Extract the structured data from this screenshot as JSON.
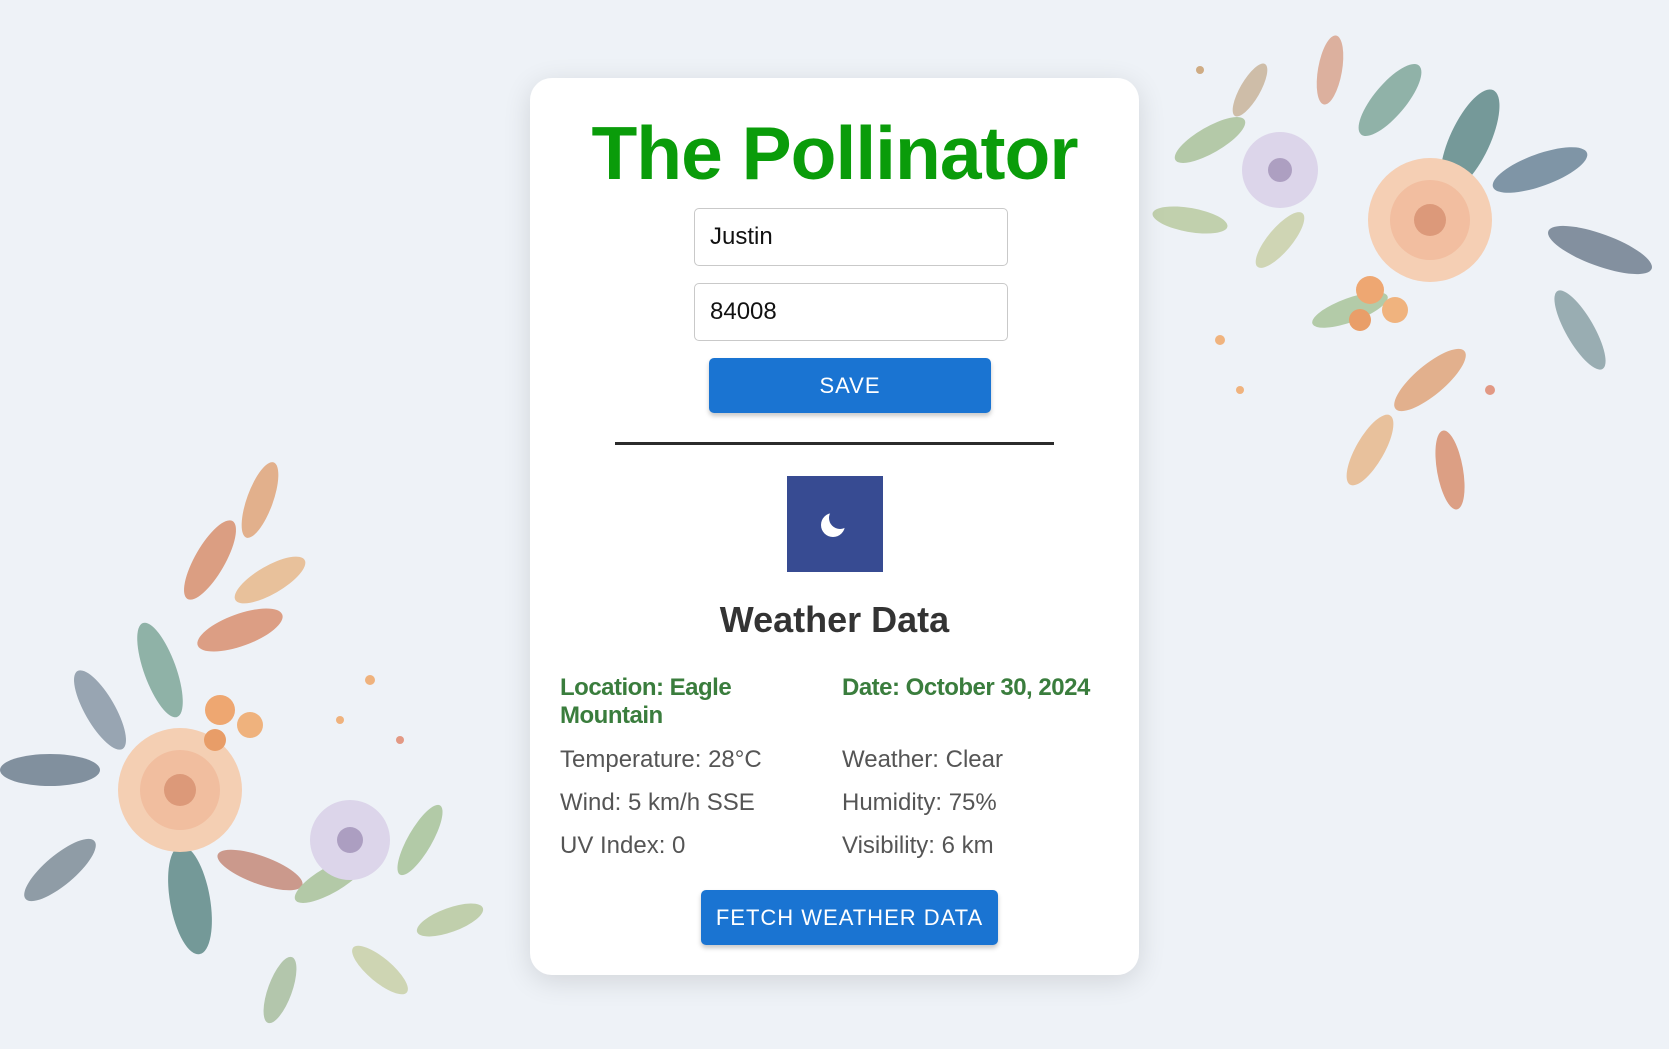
{
  "app": {
    "title": "The Pollinator"
  },
  "form": {
    "name_value": "Justin",
    "zip_value": "84008",
    "save_label": "SAVE"
  },
  "weather": {
    "icon": "crescent-moon-icon",
    "heading": "Weather Data",
    "location": "Location: Eagle Mountain",
    "date": "Date: October 30, 2024",
    "temperature": "Temperature: 28°C",
    "condition": "Weather: Clear",
    "wind": "Wind: 5 km/h SSE",
    "humidity": "Humidity: 75%",
    "uv_index": "UV Index: 0",
    "visibility": "Visibility: 6 km",
    "fetch_label": "FETCH WEATHER DATA"
  },
  "colors": {
    "title_green": "#0a9c0a",
    "label_green": "#3a7d3d",
    "button_blue": "#1a74d2",
    "icon_bg": "#374b92",
    "page_bg": "#eef2f7"
  }
}
